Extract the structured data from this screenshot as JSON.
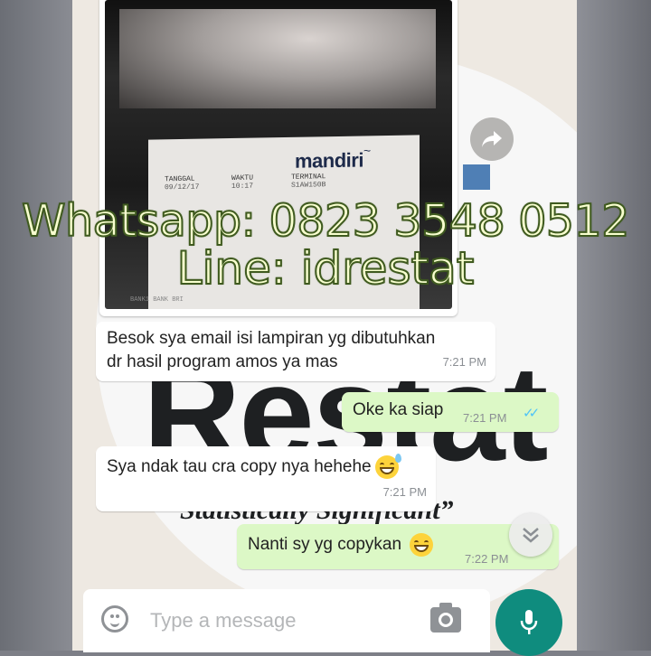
{
  "chat": {
    "receipt_image": {
      "brand": "mandiri",
      "headers": [
        "TANGGAL",
        "WAKTU",
        "TERMINAL"
      ],
      "values": [
        "09/12/17",
        "10:17",
        "S1AW150B"
      ],
      "footer_line": "BANK1 BANK BRI"
    },
    "messages": [
      {
        "direction": "in",
        "text_line1": "Besok sya email isi lampiran yg dibutuhkan",
        "text_line2": "dr hasil program amos ya mas",
        "time": "7:21 PM"
      },
      {
        "direction": "out",
        "text": "Oke ka siap",
        "time": "7:21 PM",
        "ticks": "✓✓"
      },
      {
        "direction": "in",
        "text": "Sya ndak tau cra copy nya hehehe",
        "emoji": "sweat-smile",
        "time": "7:21 PM"
      },
      {
        "direction": "out",
        "text": "Nanti sy yg copykan",
        "emoji": "grin",
        "time": "7:22 PM"
      }
    ]
  },
  "background_logo": {
    "text": "Restat",
    "tagline": "“Statistically Significant”"
  },
  "watermark": {
    "line1": "Whatsapp: 0823 3548 0512",
    "line2": "Line: idrestat"
  },
  "composer": {
    "placeholder": "Type a message"
  },
  "icons": {
    "forward": "forward-icon",
    "emoji": "emoji-icon",
    "camera": "camera-icon",
    "mic": "mic-icon",
    "scroll_down": "double-chevron-down-icon"
  },
  "colors": {
    "outgoing_bubble": "#dcf8c6",
    "incoming_bubble": "#ffffff",
    "mic_button": "#0f8c7e",
    "read_ticks": "#4fc3f7"
  }
}
